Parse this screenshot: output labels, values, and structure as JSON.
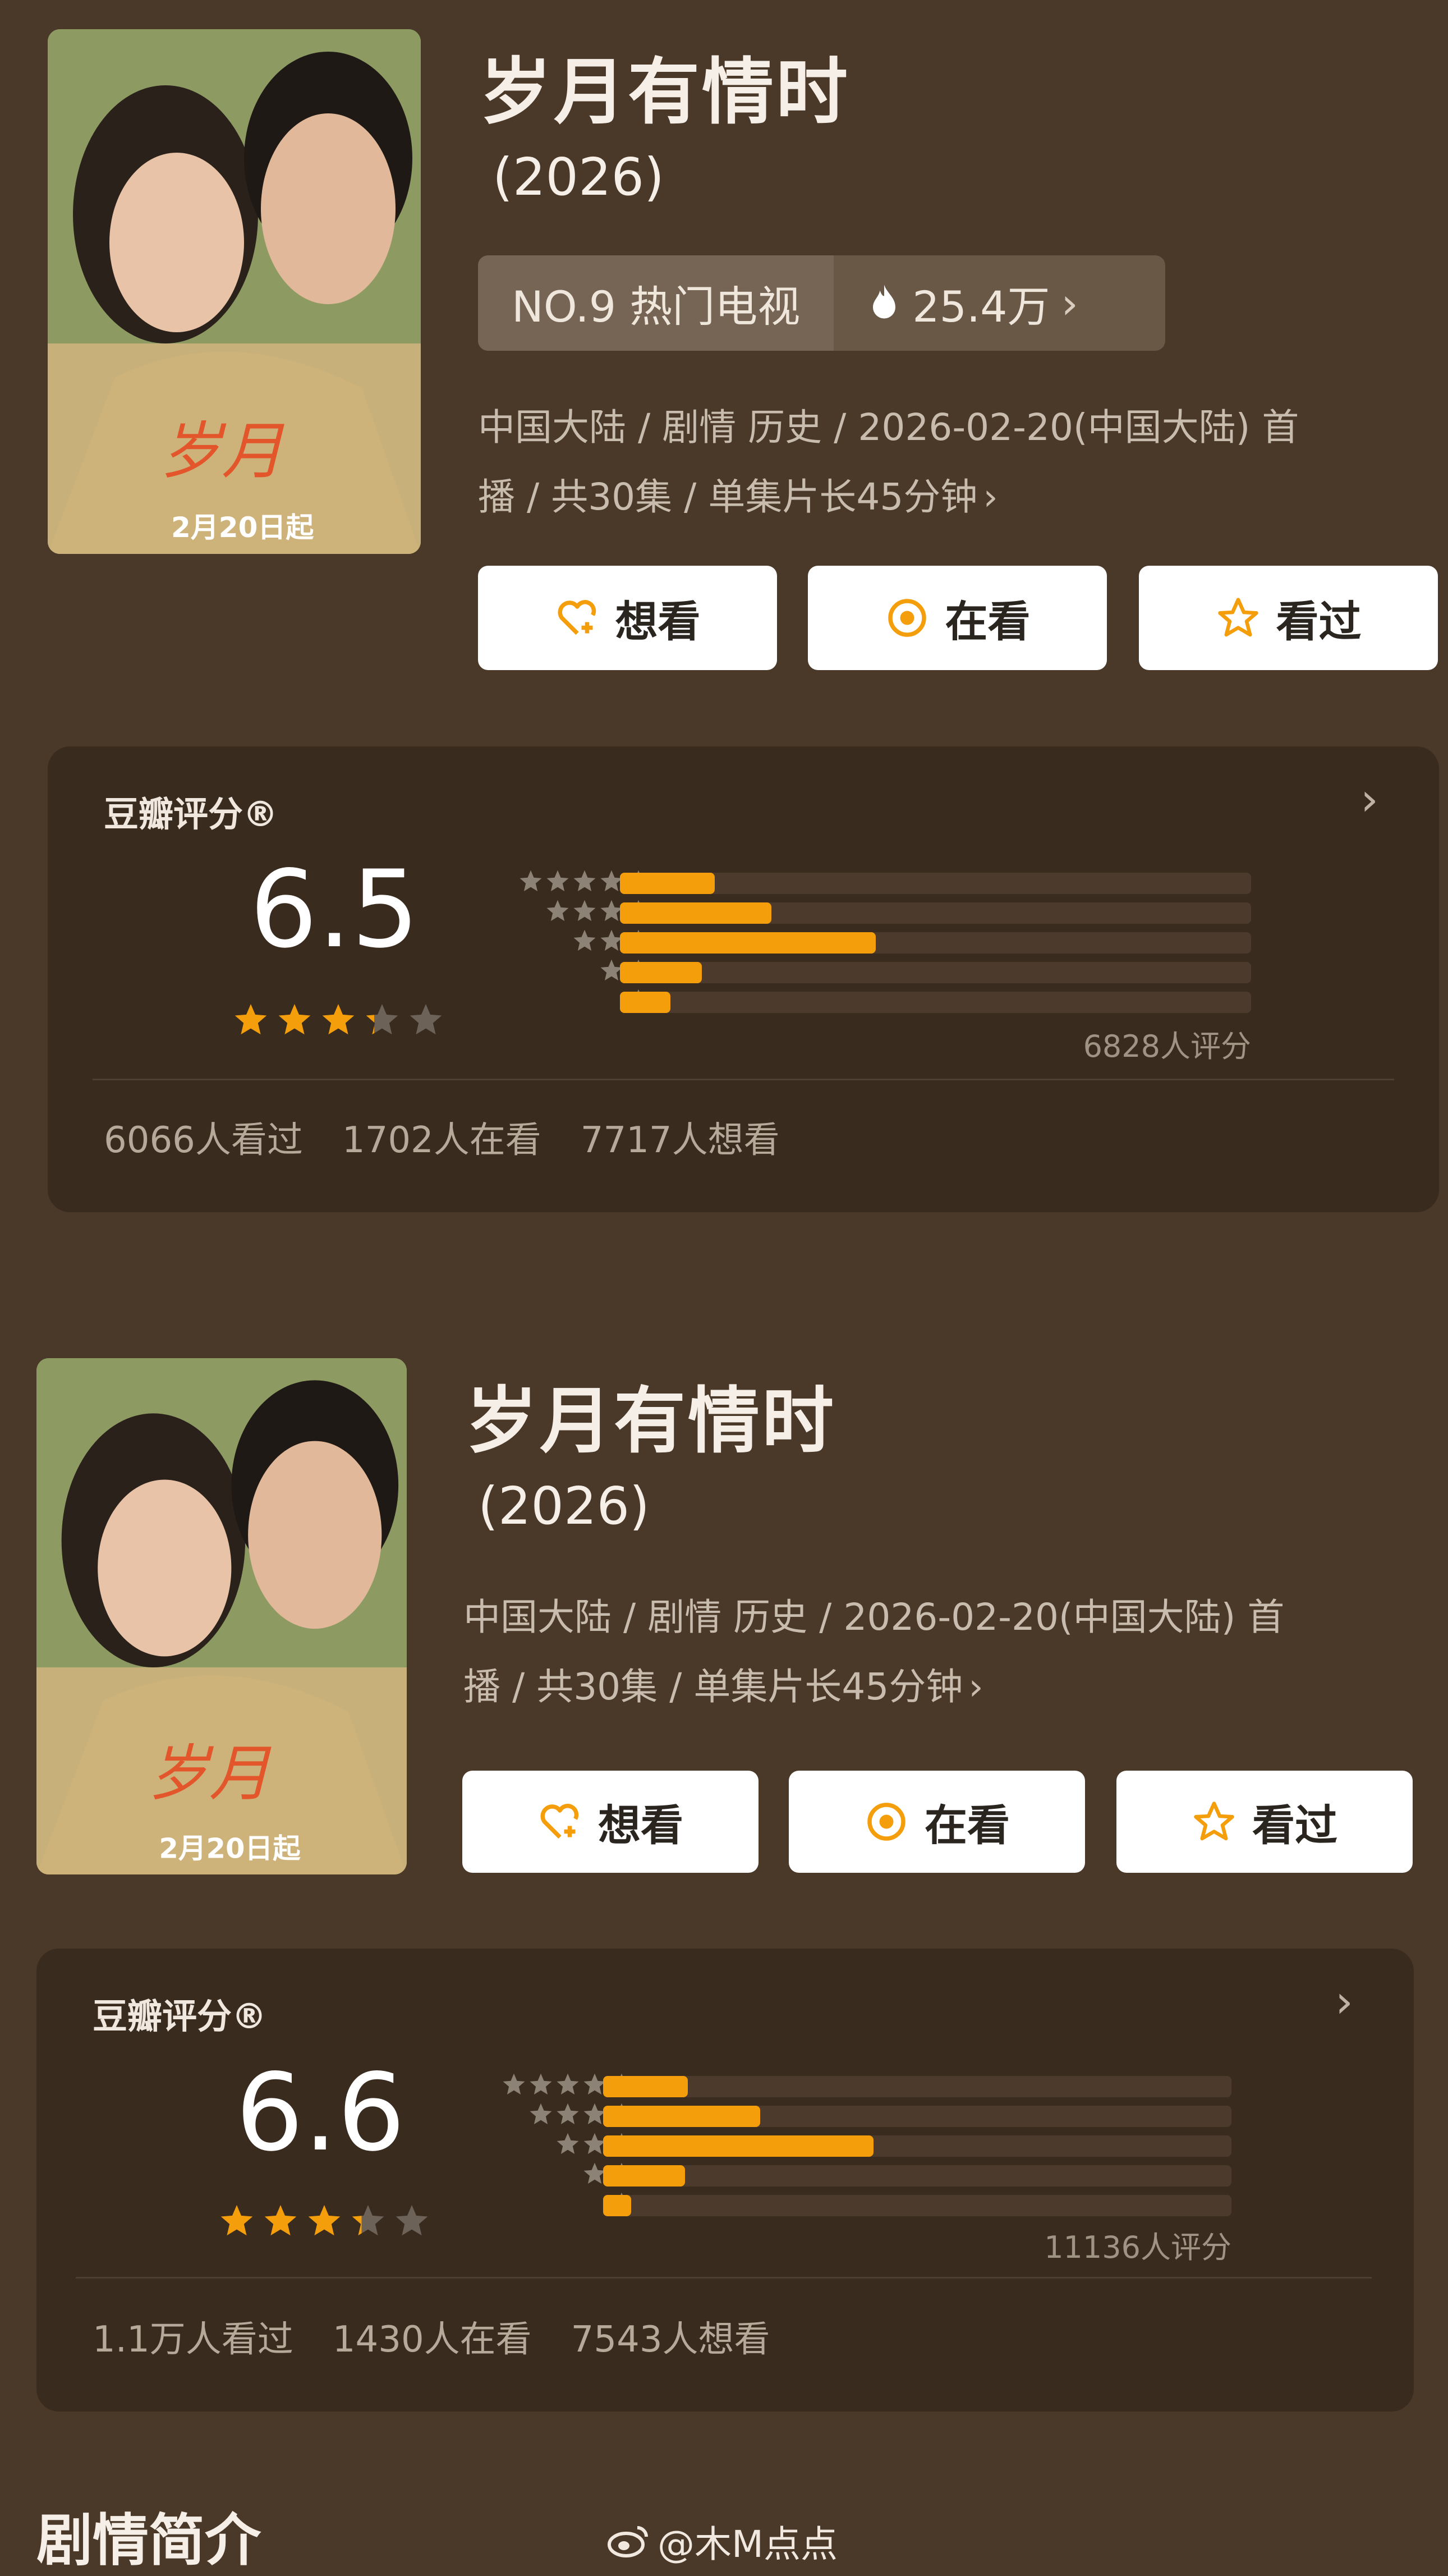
{
  "colors": {
    "background": "#4a3828",
    "card": "#3a2b1f",
    "accent": "#f59e0b",
    "button_bg": "#ffffff"
  },
  "top": {
    "poster_text": "2月20日起",
    "title": "岁月有情时",
    "year": "(2026)",
    "rank_label": "NO.9 热门电视",
    "heat_value": "25.4万",
    "meta_line1": "中国大陆 / 剧情 历史 / 2026-02-20(中国大陆) 首",
    "meta_line2": "播 / 共30集 / 单集片长45分钟",
    "buttons": {
      "want": "想看",
      "watching": "在看",
      "watched": "看过"
    },
    "rating": {
      "label": "豆瓣评分®",
      "score": "6.5",
      "star_fill": 3.25,
      "distribution": [
        0.15,
        0.24,
        0.405,
        0.13,
        0.08
      ],
      "votes": "6828人评分",
      "watched": "6066人看过",
      "watching": "1702人在看",
      "want": "7717人想看"
    }
  },
  "bottom": {
    "poster_text": "2月20日起",
    "title": "岁月有情时",
    "year": "(2026)",
    "meta_line1": "中国大陆 / 剧情 历史 / 2026-02-20(中国大陆) 首",
    "meta_line2": "播 / 共30集 / 单集片长45分钟",
    "buttons": {
      "want": "想看",
      "watching": "在看",
      "watched": "看过"
    },
    "rating": {
      "label": "豆瓣评分®",
      "score": "6.6",
      "star_fill": 3.3,
      "distribution": [
        0.135,
        0.25,
        0.43,
        0.13,
        0.045
      ],
      "votes": "11136人评分",
      "watched": "1.1万人看过",
      "watching": "1430人在看",
      "want": "7543人想看"
    }
  },
  "section": {
    "synopsis_title": "剧情简介"
  },
  "watermark": {
    "text": "@木M点点"
  },
  "icons": [
    "heart-plus-icon",
    "target-icon",
    "star-outline-icon",
    "flame-icon",
    "chevron-right-icon",
    "star-icon",
    "weibo-icon"
  ]
}
